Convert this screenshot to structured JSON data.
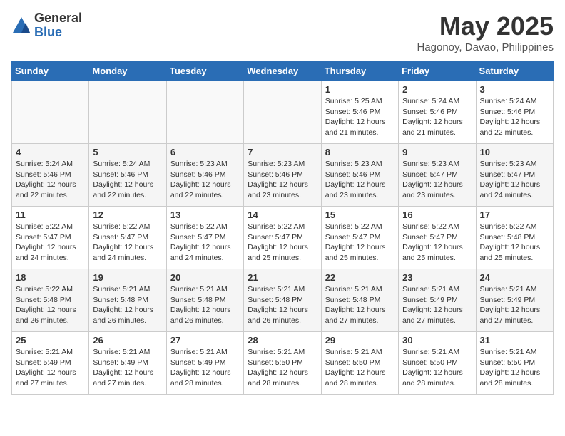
{
  "header": {
    "logo_general": "General",
    "logo_blue": "Blue",
    "month": "May 2025",
    "location": "Hagonoy, Davao, Philippines"
  },
  "weekdays": [
    "Sunday",
    "Monday",
    "Tuesday",
    "Wednesday",
    "Thursday",
    "Friday",
    "Saturday"
  ],
  "weeks": [
    [
      {
        "day": "",
        "info": ""
      },
      {
        "day": "",
        "info": ""
      },
      {
        "day": "",
        "info": ""
      },
      {
        "day": "",
        "info": ""
      },
      {
        "day": "1",
        "info": "Sunrise: 5:25 AM\nSunset: 5:46 PM\nDaylight: 12 hours\nand 21 minutes."
      },
      {
        "day": "2",
        "info": "Sunrise: 5:24 AM\nSunset: 5:46 PM\nDaylight: 12 hours\nand 21 minutes."
      },
      {
        "day": "3",
        "info": "Sunrise: 5:24 AM\nSunset: 5:46 PM\nDaylight: 12 hours\nand 22 minutes."
      }
    ],
    [
      {
        "day": "4",
        "info": "Sunrise: 5:24 AM\nSunset: 5:46 PM\nDaylight: 12 hours\nand 22 minutes."
      },
      {
        "day": "5",
        "info": "Sunrise: 5:24 AM\nSunset: 5:46 PM\nDaylight: 12 hours\nand 22 minutes."
      },
      {
        "day": "6",
        "info": "Sunrise: 5:23 AM\nSunset: 5:46 PM\nDaylight: 12 hours\nand 22 minutes."
      },
      {
        "day": "7",
        "info": "Sunrise: 5:23 AM\nSunset: 5:46 PM\nDaylight: 12 hours\nand 23 minutes."
      },
      {
        "day": "8",
        "info": "Sunrise: 5:23 AM\nSunset: 5:46 PM\nDaylight: 12 hours\nand 23 minutes."
      },
      {
        "day": "9",
        "info": "Sunrise: 5:23 AM\nSunset: 5:47 PM\nDaylight: 12 hours\nand 23 minutes."
      },
      {
        "day": "10",
        "info": "Sunrise: 5:23 AM\nSunset: 5:47 PM\nDaylight: 12 hours\nand 24 minutes."
      }
    ],
    [
      {
        "day": "11",
        "info": "Sunrise: 5:22 AM\nSunset: 5:47 PM\nDaylight: 12 hours\nand 24 minutes."
      },
      {
        "day": "12",
        "info": "Sunrise: 5:22 AM\nSunset: 5:47 PM\nDaylight: 12 hours\nand 24 minutes."
      },
      {
        "day": "13",
        "info": "Sunrise: 5:22 AM\nSunset: 5:47 PM\nDaylight: 12 hours\nand 24 minutes."
      },
      {
        "day": "14",
        "info": "Sunrise: 5:22 AM\nSunset: 5:47 PM\nDaylight: 12 hours\nand 25 minutes."
      },
      {
        "day": "15",
        "info": "Sunrise: 5:22 AM\nSunset: 5:47 PM\nDaylight: 12 hours\nand 25 minutes."
      },
      {
        "day": "16",
        "info": "Sunrise: 5:22 AM\nSunset: 5:47 PM\nDaylight: 12 hours\nand 25 minutes."
      },
      {
        "day": "17",
        "info": "Sunrise: 5:22 AM\nSunset: 5:48 PM\nDaylight: 12 hours\nand 25 minutes."
      }
    ],
    [
      {
        "day": "18",
        "info": "Sunrise: 5:22 AM\nSunset: 5:48 PM\nDaylight: 12 hours\nand 26 minutes."
      },
      {
        "day": "19",
        "info": "Sunrise: 5:21 AM\nSunset: 5:48 PM\nDaylight: 12 hours\nand 26 minutes."
      },
      {
        "day": "20",
        "info": "Sunrise: 5:21 AM\nSunset: 5:48 PM\nDaylight: 12 hours\nand 26 minutes."
      },
      {
        "day": "21",
        "info": "Sunrise: 5:21 AM\nSunset: 5:48 PM\nDaylight: 12 hours\nand 26 minutes."
      },
      {
        "day": "22",
        "info": "Sunrise: 5:21 AM\nSunset: 5:48 PM\nDaylight: 12 hours\nand 27 minutes."
      },
      {
        "day": "23",
        "info": "Sunrise: 5:21 AM\nSunset: 5:49 PM\nDaylight: 12 hours\nand 27 minutes."
      },
      {
        "day": "24",
        "info": "Sunrise: 5:21 AM\nSunset: 5:49 PM\nDaylight: 12 hours\nand 27 minutes."
      }
    ],
    [
      {
        "day": "25",
        "info": "Sunrise: 5:21 AM\nSunset: 5:49 PM\nDaylight: 12 hours\nand 27 minutes."
      },
      {
        "day": "26",
        "info": "Sunrise: 5:21 AM\nSunset: 5:49 PM\nDaylight: 12 hours\nand 27 minutes."
      },
      {
        "day": "27",
        "info": "Sunrise: 5:21 AM\nSunset: 5:49 PM\nDaylight: 12 hours\nand 28 minutes."
      },
      {
        "day": "28",
        "info": "Sunrise: 5:21 AM\nSunset: 5:50 PM\nDaylight: 12 hours\nand 28 minutes."
      },
      {
        "day": "29",
        "info": "Sunrise: 5:21 AM\nSunset: 5:50 PM\nDaylight: 12 hours\nand 28 minutes."
      },
      {
        "day": "30",
        "info": "Sunrise: 5:21 AM\nSunset: 5:50 PM\nDaylight: 12 hours\nand 28 minutes."
      },
      {
        "day": "31",
        "info": "Sunrise: 5:21 AM\nSunset: 5:50 PM\nDaylight: 12 hours\nand 28 minutes."
      }
    ]
  ]
}
